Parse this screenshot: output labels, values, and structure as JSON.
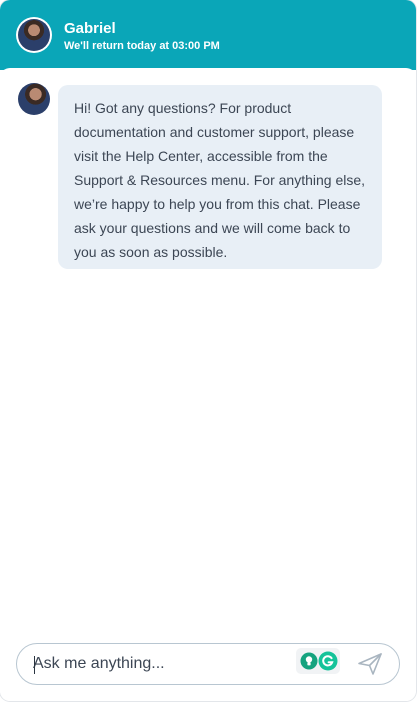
{
  "header": {
    "agent_name": "Gabriel",
    "status_text": "We'll return today at 03:00 PM",
    "background_color": "#0aa6b8"
  },
  "conversation": {
    "messages": [
      {
        "sender": "agent",
        "text": "Hi! Got any questions? For product documentation and customer support, please visit the Help Center, accessible from the Support & Resources menu. For anything else, we’re happy to help you from this chat. Please ask your questions and we will come back to you as soon as possible."
      }
    ]
  },
  "composer": {
    "placeholder": "Ask me anything...",
    "value": "",
    "send_icon": "paper-plane-icon",
    "extension_icons": [
      "lightbulb-icon",
      "grammarly-icon"
    ]
  },
  "colors": {
    "bubble": "#e8eff6",
    "text": "#3c4654",
    "accent": "#0aa6b8",
    "grammarly": "#15c39a"
  }
}
